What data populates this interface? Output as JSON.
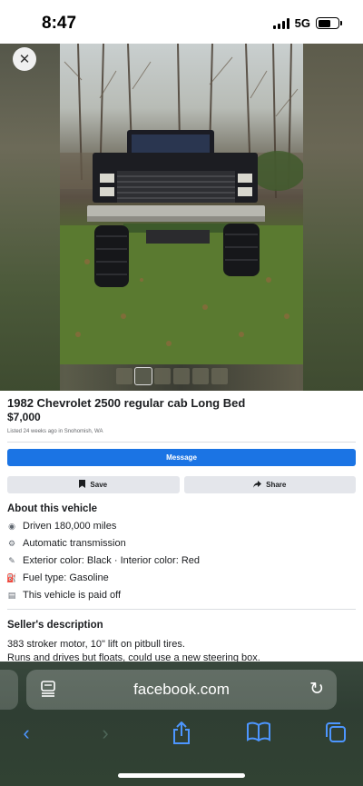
{
  "status": {
    "time": "8:47",
    "network": "5G"
  },
  "listing": {
    "title": "1982 Chevrolet 2500 regular cab Long Bed",
    "price": "$7,000",
    "meta": "Listed 24 weeks ago in Snohomish, WA"
  },
  "actions": {
    "message": "Message",
    "save": "Save",
    "share": "Share"
  },
  "about": {
    "title": "About this vehicle",
    "details": [
      {
        "icon": "odometer-icon",
        "text": "Driven 180,000 miles"
      },
      {
        "icon": "transmission-icon",
        "text": "Automatic transmission"
      },
      {
        "icon": "paint-icon",
        "text": "Exterior color: Black · Interior color: Red"
      },
      {
        "icon": "fuel-icon",
        "text": "Fuel type: Gasoline"
      },
      {
        "icon": "document-icon",
        "text": "This vehicle is paid off"
      }
    ]
  },
  "seller": {
    "title": "Seller's description",
    "lines": [
      "383 stroker motor, 10\" lift on pitbull tires.",
      "Runs and drives but floats, could use a new steering box."
    ]
  },
  "browser": {
    "url": "facebook.com"
  }
}
